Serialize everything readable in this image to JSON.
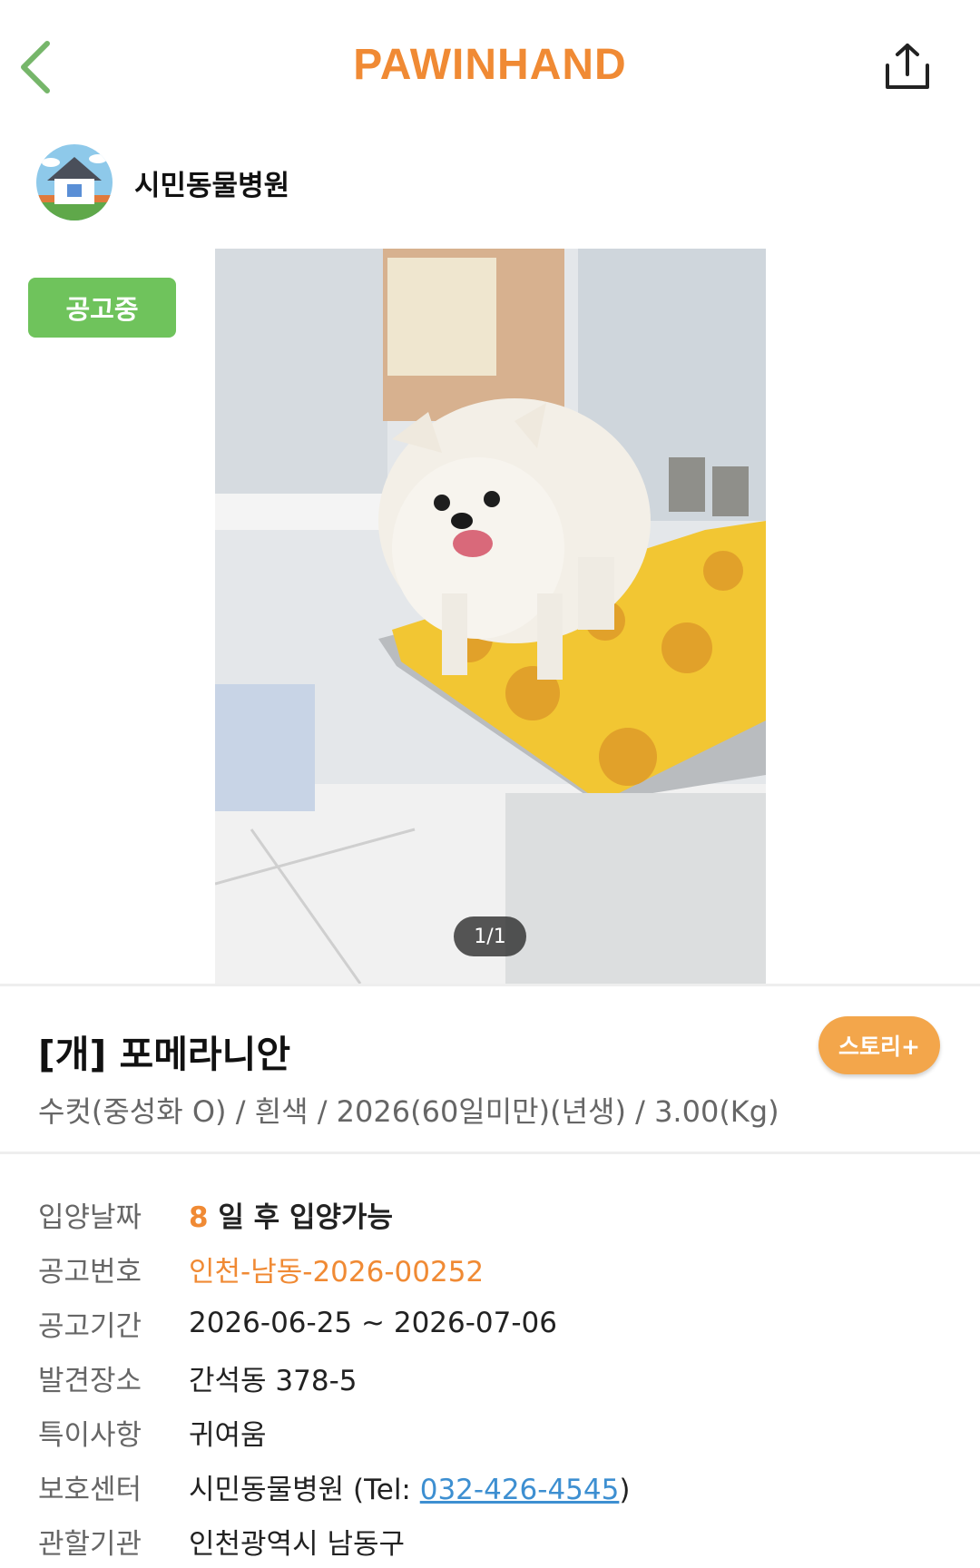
{
  "header": {
    "brand": "PAWINHAND",
    "back_icon": "chevron-left-icon",
    "share_icon": "share-icon"
  },
  "colors": {
    "brand": "#f08a34",
    "status_green": "#6fc35c",
    "story_orange": "#f3a64b",
    "link_blue": "#3d8fd1"
  },
  "shelter": {
    "name": "시민동물병원",
    "avatar_icon": "house-icon"
  },
  "listing": {
    "status": "공고중",
    "photo_counter": "1/1",
    "photo_description_icon": "dog-photo",
    "title": "[개] 포메라니안",
    "story_button": "스토리+",
    "summary": "수컷(중성화 O) / 흰색 / 2026(60일미만)(년생) / 3.00(Kg)"
  },
  "info": {
    "adoption_date": {
      "label": "입양날짜",
      "days": "8",
      "text": "일 후 입양가능"
    },
    "notice_no": {
      "label": "공고번호",
      "value": "인천-남동-2026-00252"
    },
    "notice_period": {
      "label": "공고기간",
      "value": "2026-06-25 ~ 2026-07-06"
    },
    "found_place": {
      "label": "발견장소",
      "value": "간석동 378-5"
    },
    "features": {
      "label": "특이사항",
      "value": "귀여움"
    },
    "center": {
      "label": "보호센터",
      "name": "시민동물병원",
      "tel_prefix": " (Tel: ",
      "phone": "032-426-4545",
      "tel_suffix": ")"
    },
    "jurisdiction": {
      "label": "관할기관",
      "value": "인천광역시 남동구"
    }
  }
}
